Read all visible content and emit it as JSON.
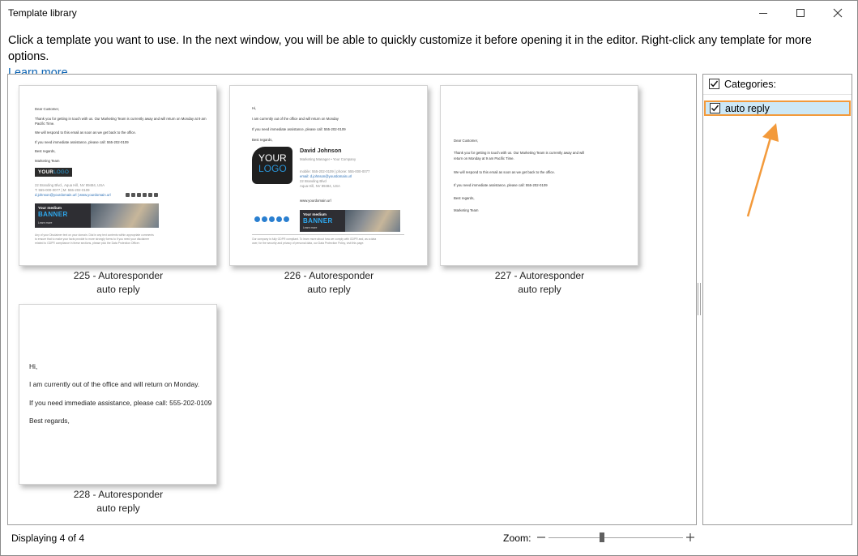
{
  "window": {
    "title": "Template library",
    "controls": {
      "minimize": "minimize-icon",
      "maximize": "maximize-icon",
      "close": "close-icon"
    }
  },
  "instructions": {
    "text": "Click a template you want to use. In the next window, you will be able to quickly customize it before opening it in the editor. Right-click any template for more options.",
    "link": "Learn more."
  },
  "templates": [
    {
      "name": "225 - Autoresponder",
      "category": "auto reply",
      "preview": {
        "greeting": "Dear Customer,",
        "line1": "Thank you for getting in touch with us. Our Marketing Team is currently away and will return on Monday at 9 am",
        "line1b": "Pacific Time.",
        "line2": "We will respond to this email as soon as we get back to the office.",
        "line3": "If you need immediate assistance, please call: 555-202-0109",
        "closing": "Best regards,",
        "team": "Marketing Team",
        "logo_a": "YOUR",
        "logo_b": "LOGO",
        "addr1": "22 Branding Blvd., Aqua Hill, NV 89484, USA",
        "addr2": "T: 555-000-0077  |  M: 555-202-0109",
        "addr3": "d.johnson@yourdomain.url  |  www.yourdomain.url",
        "banner_a": "Your medium",
        "banner_b": "BANNER",
        "banner_c": "Learn more",
        "disclaimer1": "Any of your Disclaimer text on your domain. Dial in any text contents within appropriate comments",
        "disclaimer2": "to ensure that to make your facts provide to more strongly forms to if you need your disclaimer",
        "disclaimer3": "related to GDPR compliance in these sections, please pick the Data Protection Officer."
      }
    },
    {
      "name": "226 - Autoresponder",
      "category": "auto reply",
      "preview": {
        "greeting": "Hi,",
        "line1": "I am currently out of the office and will return on Monday",
        "line2": "If you need immediate assistance, please call: 555-202-0109",
        "closing": "Best regards,",
        "person": "David Johnson",
        "role": "Marketing Manager • Your Company",
        "logo_a": "YOUR",
        "logo_b": "LOGO",
        "contact1": "mobile: 555-202-0109  |  phone: 555-000-0077",
        "contact2": "email: d.johnson@yourdomain.url",
        "contact3": "22 Branding Blvd",
        "contact4": "Aqua Hill, NV 89484, USA",
        "website": "www.yourdomain.url",
        "banner_a": "Your medium",
        "banner_b": "BANNER",
        "banner_c": "Learn more",
        "disclaimer1": "Our company is fully GDPR compliant. To learn more about how we comply with GDPR and, as a data",
        "disclaimer2": "user, for the security and privacy of personal data, our Data Protection Policy, visit this page."
      }
    },
    {
      "name": "227 - Autoresponder",
      "category": "auto reply",
      "preview": {
        "greeting": "Dear Customer,",
        "line1": "Thank you for getting in touch with us. Our Marketing Team is currently away and will",
        "line1b": "return on Monday at 9 am Pacific Time.",
        "line2": "We will respond to this email as soon as we get back to the office.",
        "line3": "If you need immediate assistance, please call: 555-202-0109",
        "closing": "Best regards,",
        "team": "Marketing Team"
      }
    },
    {
      "name": "228 - Autoresponder",
      "category": "auto reply",
      "preview": {
        "greeting": "Hi,",
        "line1": "I am currently out of the office and will return on Monday.",
        "line2": "If you need immediate assistance, please call: 555-202-0109",
        "closing": "Best regards,"
      }
    }
  ],
  "categories": {
    "header": "Categories:",
    "header_checked": true,
    "items": [
      {
        "label": "auto reply",
        "checked": true,
        "highlighted": true
      }
    ]
  },
  "status": {
    "displaying": "Displaying 4 of 4"
  },
  "zoom": {
    "label": "Zoom:",
    "minus": "−",
    "plus": "+",
    "level": 0.4
  },
  "colors": {
    "accent_link": "#0b63b3",
    "highlight_border": "#f39a3b",
    "selection_bg": "#cde8f6",
    "arrow": "#f39a3b"
  }
}
